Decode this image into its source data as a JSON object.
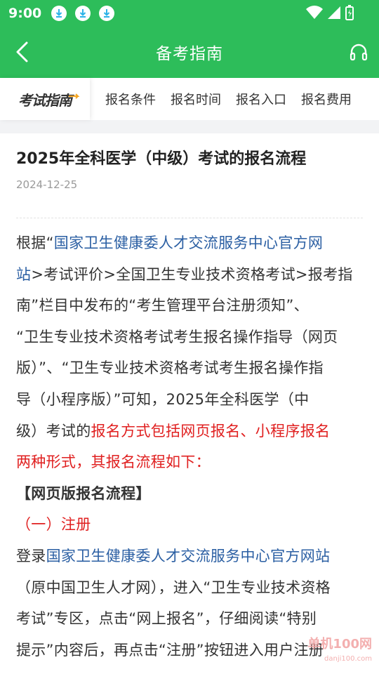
{
  "status_bar": {
    "time": "9:00"
  },
  "app_bar": {
    "title": "备考指南"
  },
  "tabs": {
    "logo_text": "考试指南",
    "items": [
      "报名条件",
      "报名时间",
      "报名入口",
      "报名费用"
    ]
  },
  "article": {
    "title": "2025年全科医学（中级）考试的报名流程",
    "date": "2024-12-25",
    "p1": {
      "a": "根据“",
      "b_link": "国家卫生健康委人才交流服务中心官方网",
      "c_link": "站",
      "d": ">考试评价>全国卫生专业技术资格考试>报考指",
      "e": "南”栏目中发布的“考生管理平台注册须知”、",
      "f": "“卫生专业技术资格考试考生报名操作指导（网页",
      "g": "版）”、“卫生专业技术资格考试考生报名操作指",
      "h": "导（小程序版）”可知，2025年全科医学（中",
      "i": "级）考试的",
      "j_red": "报名方式包括网页报名、小程序报名",
      "k_red": "两种形式，其报名流程如下："
    },
    "section1": "【网页版报名流程】",
    "sub1": "（一）注册",
    "p2": {
      "a": "登录",
      "b_link": "国家卫生健康委人才交流服务中心官方网站",
      "c": "（原中国卫生人才网），进入“卫生专业技术资格",
      "d": "考试”专区，点击“网上报名”，仔细阅读“特别",
      "e": "提示”内容后，再点击“注册”按钮进入用户注册"
    }
  },
  "watermark": {
    "text": "单机100网",
    "sub": "danji100.com"
  },
  "colors": {
    "primary": "#2dbd5a",
    "link": "#2b5fa3",
    "highlight": "#e02020"
  }
}
